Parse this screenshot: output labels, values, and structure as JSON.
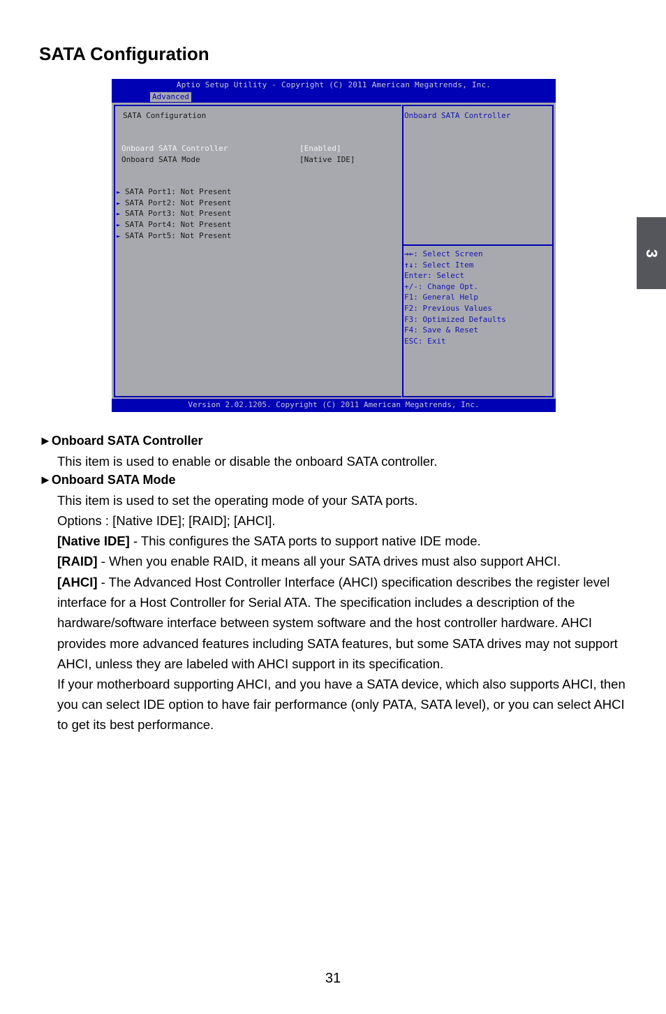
{
  "page": {
    "title": "SATA Configuration",
    "chapter_tab": "3",
    "page_number": "31"
  },
  "bios": {
    "header": "Aptio Setup Utility - Copyright (C) 2011 American Megatrends, Inc.",
    "active_tab": "Advanced",
    "screen_title": "SATA Configuration",
    "settings": [
      {
        "label": "Onboard SATA Controller",
        "value": "[Enabled]",
        "selected": true
      },
      {
        "label": "Onboard SATA Mode",
        "value": "[Native IDE]",
        "selected": false
      }
    ],
    "ports": [
      {
        "label": "SATA Port1: Not Present"
      },
      {
        "label": "SATA Port2: Not Present"
      },
      {
        "label": "SATA Port3: Not Present"
      },
      {
        "label": "SATA Port4: Not Present"
      },
      {
        "label": "SATA Port5: Not Present"
      }
    ],
    "help_text": "Onboard SATA Controller",
    "keys": [
      {
        "key": "→←",
        "desc": ": Select Screen"
      },
      {
        "key": "↑↓",
        "desc": ": Select Item"
      },
      {
        "key": "Enter",
        "desc": ": Select"
      },
      {
        "key": "+/-",
        "desc": ": Change Opt."
      },
      {
        "key": "F1",
        "desc": ": General Help"
      },
      {
        "key": "F2",
        "desc": ": Previous Values"
      },
      {
        "key": "F3",
        "desc": ": Optimized Defaults"
      },
      {
        "key": "F4",
        "desc": ": Save & Reset"
      },
      {
        "key": "ESC",
        "desc": ": Exit"
      }
    ],
    "footer": "Version 2.02.1205. Copyright (C) 2011 American Megatrends, Inc.",
    "colors": {
      "blue": "#0000b4",
      "gray": "#a8a9ae"
    }
  },
  "sections": [
    {
      "heading": "►Onboard SATA Controller",
      "paragraphs": [
        {
          "text": "This item is used to enable or disable the onboard SATA controller."
        }
      ]
    },
    {
      "heading": "►Onboard SATA Mode",
      "paragraphs": [
        {
          "text": "This item is used to set the operating mode of your SATA ports."
        },
        {
          "text": "Options : [Native IDE]; [RAID]; [AHCI]."
        },
        {
          "bold": "[Native IDE]",
          "text": " - This configures the SATA ports to support native IDE mode."
        },
        {
          "bold": "[RAID]",
          "text": " - When you enable RAID, it means all your SATA drives must also support AHCI."
        },
        {
          "bold": "[AHCI]",
          "text": " - The Advanced Host Controller Interface (AHCI) specification describes the register level interface for a Host Controller for Serial ATA. The specification includes a description of the hardware/software interface between system software and the host controller hardware. AHCI provides more advanced features including SATA features, but some SATA drives may not support AHCI, unless they are labeled with AHCI support in its specification."
        },
        {
          "text": "If your motherboard supporting AHCI, and you have a SATA device, which also supports AHCI, then you can select IDE option to have fair performance (only PATA, SATA level), or you can select AHCI to get its best performance."
        }
      ]
    }
  ]
}
